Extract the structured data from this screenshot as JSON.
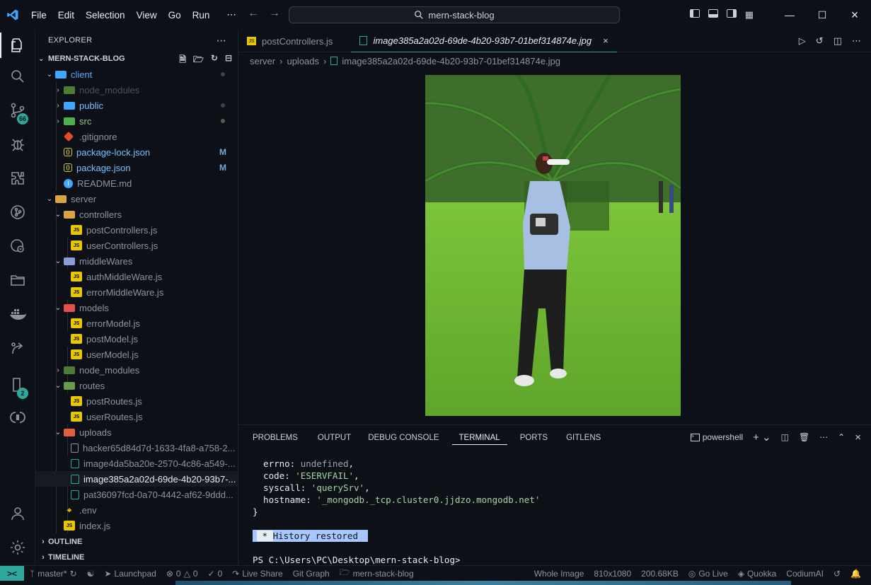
{
  "menu": [
    "File",
    "Edit",
    "Selection",
    "View",
    "Go",
    "Run",
    "⋯"
  ],
  "search": {
    "text": "mern-stack-blog"
  },
  "activity": {
    "source_control_badge": "66",
    "second_badge": "2"
  },
  "explorer": {
    "header": "EXPLORER",
    "project": "MERN-STACK-BLOG",
    "outline": "OUTLINE",
    "timeline": "TIMELINE",
    "tree": {
      "client": "client",
      "client_node_modules": "node_modules",
      "public": "public",
      "src": "src",
      "gitignore": ".gitignore",
      "package_lock": "package-lock.json",
      "package_json": "package.json",
      "readme": "README.md",
      "server": "server",
      "controllers": "controllers",
      "postControllers": "postControllers.js",
      "userControllers": "userControllers.js",
      "middleWares": "middleWares",
      "authMiddleWare": "authMiddleWare.js",
      "errorMiddleWare": "errorMiddleWare.js",
      "models": "models",
      "errorModel": "errorModel.js",
      "postModel": "postModel.js",
      "userModel": "userModel.js",
      "server_node_modules": "node_modules",
      "routes": "routes",
      "postRoutes": "postRoutes.js",
      "userRoutes": "userRoutes.js",
      "uploads": "uploads",
      "upload1": "hacker65d84d7d-1633-4fa8-a758-2...",
      "upload2": "image4da5ba20e-2570-4c86-a549-...",
      "upload3": "image385a2a02d-69de-4b20-93b7-...",
      "upload4": "pat36097fcd-0a70-4442-af62-9ddd...",
      "env": ".env",
      "index": "index.js",
      "modified": "M"
    }
  },
  "tabs": [
    {
      "label": "postControllers.js"
    },
    {
      "label": "image385a2a02d-69de-4b20-93b7-01bef314874e.jpg",
      "close": "×"
    }
  ],
  "breadcrumb": [
    "server",
    "uploads",
    "image385a2a02d-69de-4b20-93b7-01bef314874e.jpg"
  ],
  "panel": {
    "tabs": [
      "PROBLEMS",
      "OUTPUT",
      "DEBUG CONSOLE",
      "TERMINAL",
      "PORTS",
      "GITLENS"
    ],
    "shell": "powershell",
    "terminal": {
      "l1a": "  errno: ",
      "l1b": "undefined",
      "l2a": "  code: ",
      "l2b": "'ESERVFAIL'",
      "l3a": "  syscall: ",
      "l3b": "'querySrv'",
      "l4a": "  hostname: ",
      "l4b": "'_mongodb._tcp.cluster0.jjdzo.mongodb.net'",
      "l5": "}",
      "history_star": " * ",
      "history": "History restored ",
      "prompt": "PS C:\\Users\\PC\\Desktop\\mern-stack-blog>"
    }
  },
  "status": {
    "branch": "master*",
    "launchpad": "Launchpad",
    "errors": "0",
    "warnings": "0",
    "ports": "0",
    "liveshare": "Live Share",
    "gitgraph": "Git Graph",
    "workspace": "mern-stack-blog",
    "whole_image": "Whole Image",
    "dimensions": "810x1080",
    "filesize": "200.68KB",
    "golive": "Go Live",
    "quokka": "Quokka",
    "codium": "CodiumAI"
  },
  "colors": {
    "accent": "#2ea89e",
    "background": "#0d1117",
    "history_bg": "#a8c7ff"
  }
}
